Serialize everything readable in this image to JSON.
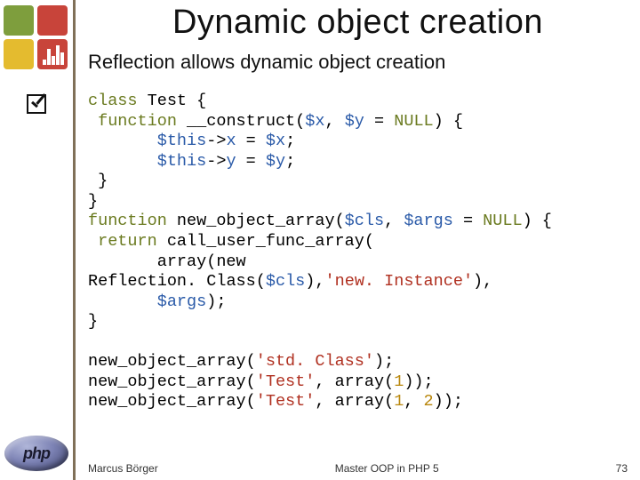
{
  "title": "Dynamic object creation",
  "lead": "Reflection allows dynamic object creation",
  "php_label": "php",
  "code": {
    "l1a": "class ",
    "l1b": "Test ",
    "l1c": "{",
    "l2a": " function ",
    "l2b": "__construct",
    "l2c": "(",
    "l2d": "$x",
    "l2e": ", ",
    "l2f": "$y ",
    "l2g": "= ",
    "l2h": "NULL",
    "l2i": ") {",
    "l3a": "       ",
    "l3b": "$this",
    "l3c": "->",
    "l3d": "x ",
    "l3e": "= ",
    "l3f": "$x",
    "l3g": ";",
    "l4a": "       ",
    "l4b": "$this",
    "l4c": "->",
    "l4d": "y ",
    "l4e": "= ",
    "l4f": "$y",
    "l4g": ";",
    "l5": " }",
    "l6": "}",
    "l7a": "function ",
    "l7b": "new_object_array",
    "l7c": "(",
    "l7d": "$cls",
    "l7e": ", ",
    "l7f": "$args ",
    "l7g": "= ",
    "l7h": "NULL",
    "l7i": ") {",
    "l8a": " return ",
    "l8b": "call_user_func_array",
    "l8c": "(",
    "l9a": "       array(new",
    "l10a": "Reflection",
    "l10b": ". ",
    "l10c": "Class",
    "l10d": "(",
    "l10e": "$cls",
    "l10f": "),",
    "l10g": "'new. Instance'",
    "l10h": "),",
    "l11a": "       ",
    "l11b": "$args",
    "l11c": ");",
    "l12": "}",
    "l14a": "new_object_array",
    "l14b": "(",
    "l14c": "'std. Class'",
    "l14d": ");",
    "l15a": "new_object_array",
    "l15b": "(",
    "l15c": "'Test'",
    "l15d": ", array(",
    "l15e": "1",
    "l15f": "));",
    "l16a": "new_object_array",
    "l16b": "(",
    "l16c": "'Test'",
    "l16d": ", array(",
    "l16e": "1",
    "l16f": ", ",
    "l16g": "2",
    "l16h": "));"
  },
  "footer": {
    "author": "Marcus Börger",
    "center": "Master OOP in PHP 5",
    "page": "73"
  }
}
